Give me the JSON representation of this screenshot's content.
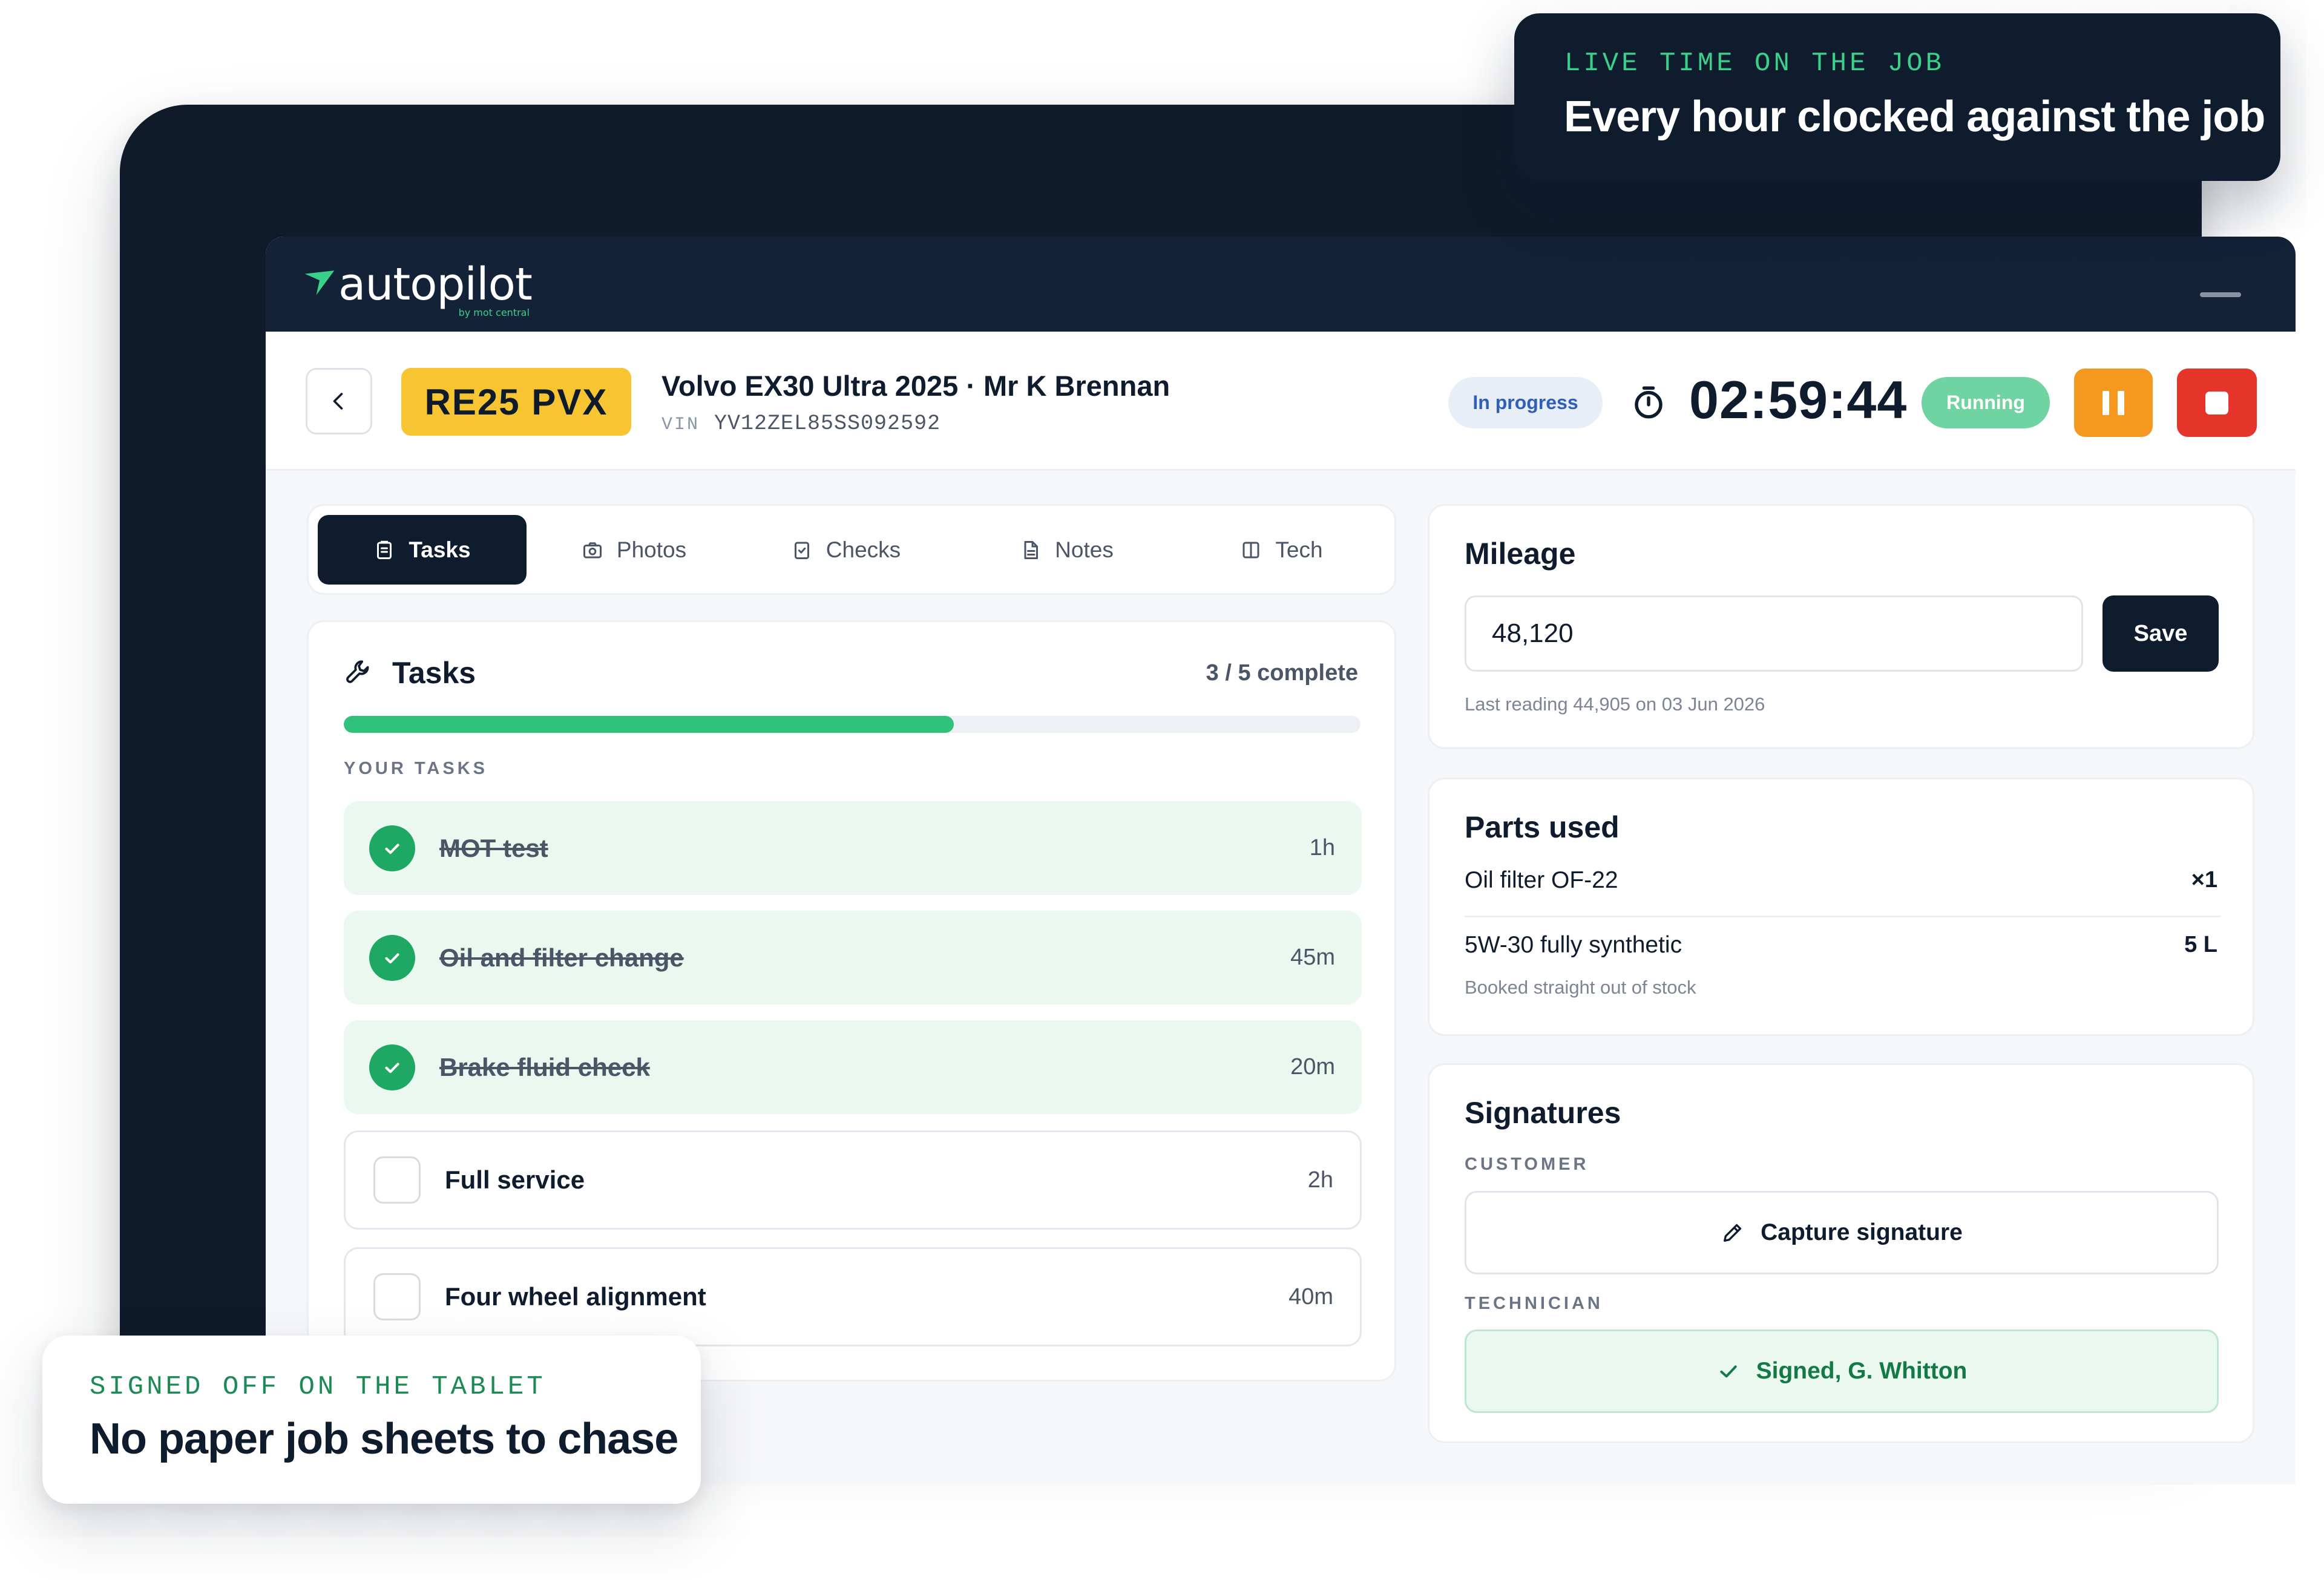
{
  "app": {
    "logo_text": "autopilot",
    "logo_subtext": "by mot central"
  },
  "job": {
    "plate": "RE25 PVX",
    "title": "Volvo EX30 Ultra 2025 · Mr K Brennan",
    "vin_label": "VIN",
    "vin": "YV12ZEL85SS092592",
    "status": "In progress",
    "timer": "02:59:44",
    "timer_state": "Running"
  },
  "tabs": [
    {
      "label": "Tasks",
      "icon": "clipboard-icon",
      "active": true
    },
    {
      "label": "Photos",
      "icon": "camera-icon",
      "active": false
    },
    {
      "label": "Checks",
      "icon": "checklist-icon",
      "active": false
    },
    {
      "label": "Notes",
      "icon": "document-icon",
      "active": false
    },
    {
      "label": "Tech",
      "icon": "columns-icon",
      "active": false
    }
  ],
  "tasks": {
    "title": "Tasks",
    "count_text": "3 / 5 complete",
    "progress": 0.6,
    "section_label": "YOUR TASKS",
    "items": [
      {
        "name": "MOT test",
        "duration": "1h",
        "done": true
      },
      {
        "name": "Oil and filter change",
        "duration": "45m",
        "done": true
      },
      {
        "name": "Brake fluid check",
        "duration": "20m",
        "done": true
      },
      {
        "name": "Full service",
        "duration": "2h",
        "done": false
      },
      {
        "name": "Four wheel alignment",
        "duration": "40m",
        "done": false
      }
    ]
  },
  "mileage": {
    "title": "Mileage",
    "value": "48,120",
    "save_label": "Save",
    "note": "Last reading 44,905 on 03 Jun 2026"
  },
  "parts": {
    "title": "Parts used",
    "items": [
      {
        "name": "Oil filter OF-22",
        "qty": "×1"
      },
      {
        "name": "5W-30 fully synthetic",
        "qty": "5 L"
      }
    ],
    "note": "Booked straight out of stock"
  },
  "signatures": {
    "title": "Signatures",
    "customer_label": "CUSTOMER",
    "capture_label": "Capture signature",
    "technician_label": "TECHNICIAN",
    "signed_label": "Signed, G. Whitton"
  },
  "callouts": {
    "top_kicker": "LIVE TIME ON THE JOB",
    "top_headline": "Every hour clocked against the job",
    "bottom_kicker": "SIGNED OFF ON THE TABLET",
    "bottom_headline": "No paper job sheets to chase"
  },
  "colors": {
    "navy": "#0f1c2e",
    "accent_green": "#2fc27a",
    "plate_yellow": "#f7c531",
    "pause_orange": "#f59820",
    "stop_red": "#e5352b",
    "running_green": "#6fd3a2",
    "status_blue": "#2f5fb8"
  }
}
